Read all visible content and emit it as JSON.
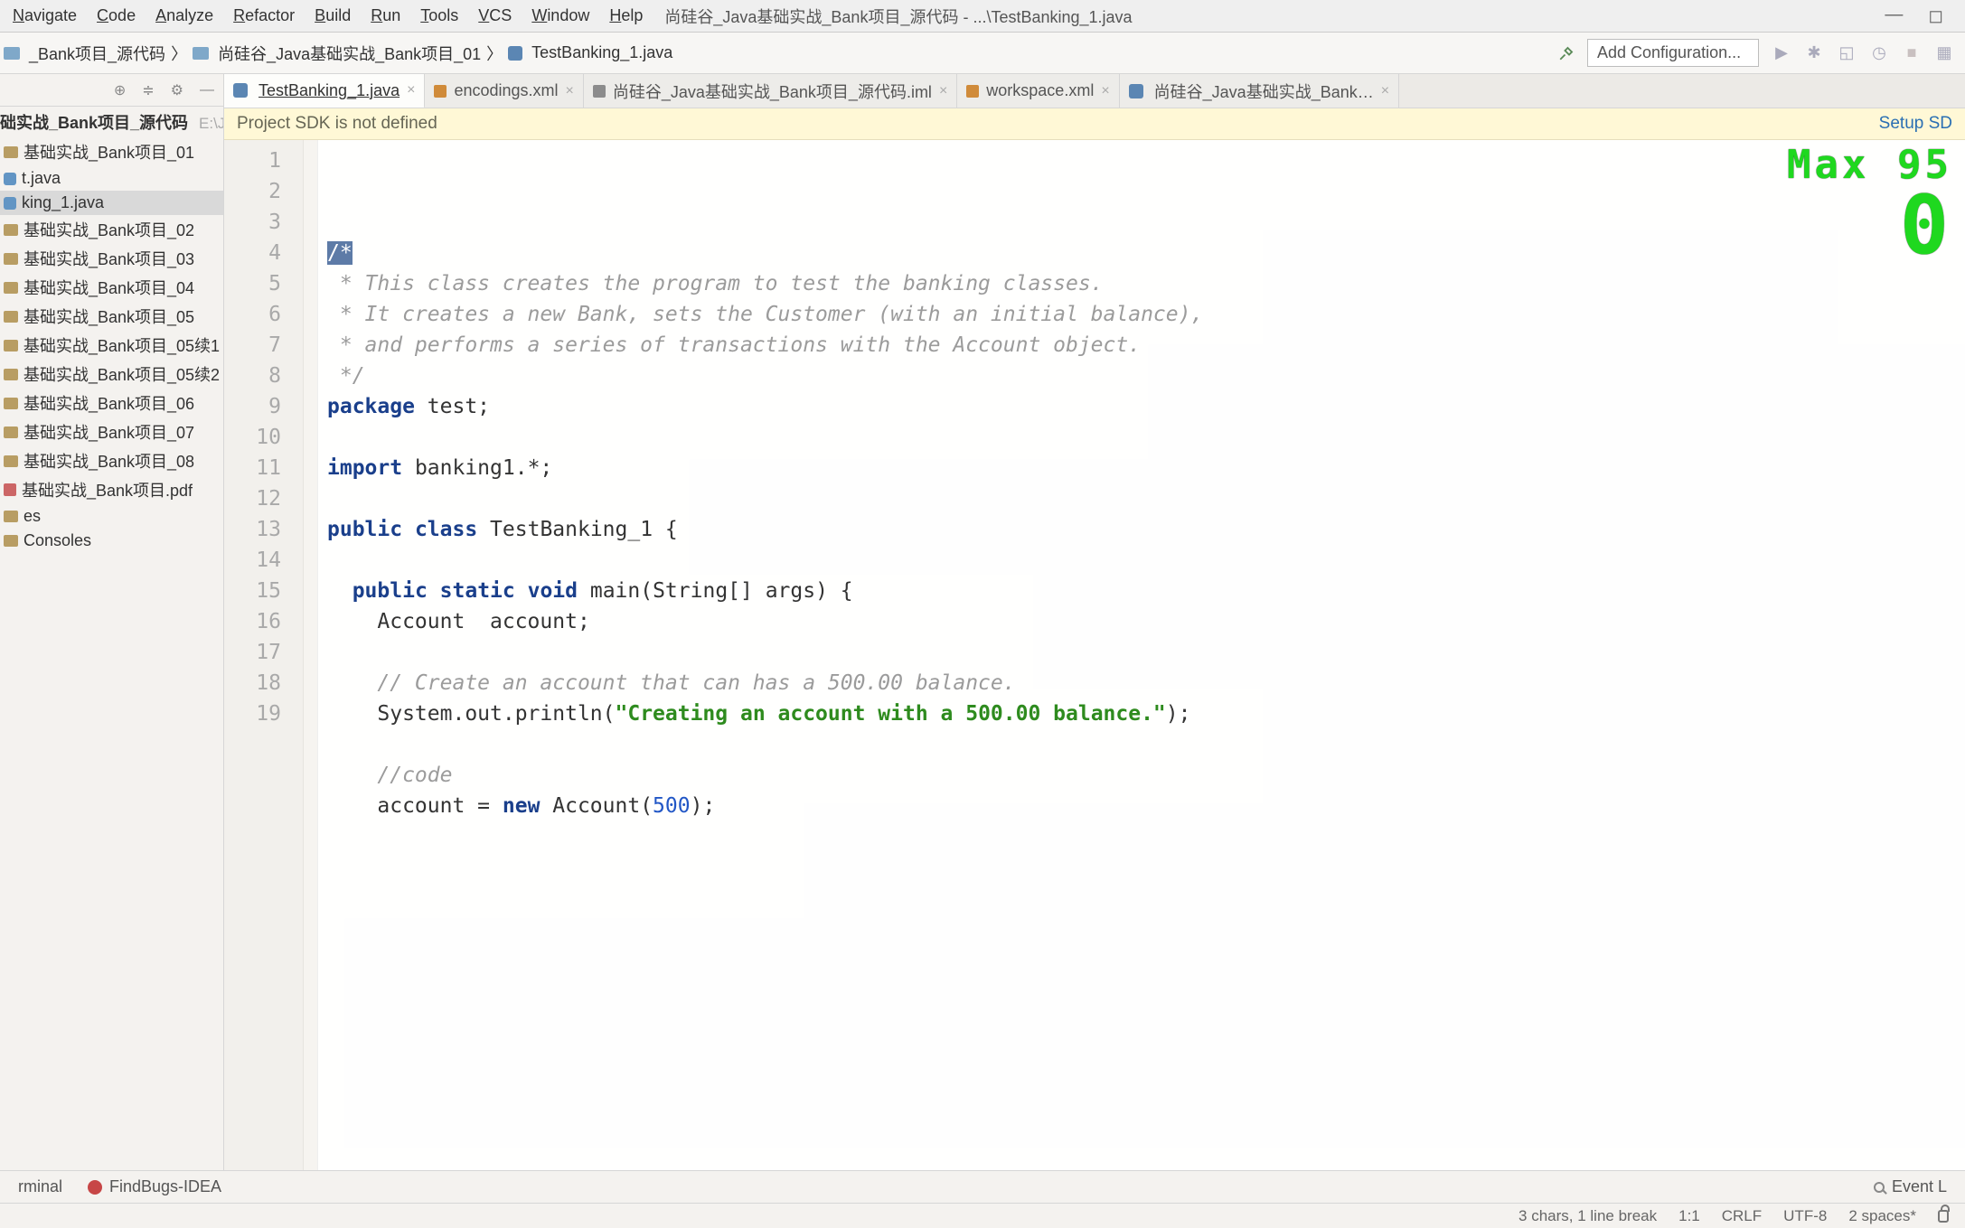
{
  "menu": [
    "Navigate",
    "Code",
    "Analyze",
    "Refactor",
    "Build",
    "Run",
    "Tools",
    "VCS",
    "Window",
    "Help"
  ],
  "window_title": "尚硅谷_Java基础实战_Bank项目_源代码 - ...\\TestBanking_1.java",
  "breadcrumbs": [
    {
      "icon": "folder",
      "label": "_Bank项目_源代码"
    },
    {
      "icon": "folder",
      "label": "尚硅谷_Java基础实战_Bank项目_01"
    },
    {
      "icon": "java",
      "label": "TestBanking_1.java"
    }
  ],
  "run_config_placeholder": "Add Configuration...",
  "sidebar": {
    "root_name": "础实战_Bank项目_源代码",
    "root_path": "E:\\Java基础",
    "items": [
      {
        "icon": "folder",
        "label": "基础实战_Bank项目_01",
        "selected": false
      },
      {
        "icon": "java",
        "label": "t.java",
        "selected": false
      },
      {
        "icon": "java",
        "label": "king_1.java",
        "selected": true
      },
      {
        "icon": "folder",
        "label": "基础实战_Bank项目_02",
        "selected": false
      },
      {
        "icon": "folder",
        "label": "基础实战_Bank项目_03",
        "selected": false
      },
      {
        "icon": "folder",
        "label": "基础实战_Bank项目_04",
        "selected": false
      },
      {
        "icon": "folder",
        "label": "基础实战_Bank项目_05",
        "selected": false
      },
      {
        "icon": "folder",
        "label": "基础实战_Bank项目_05续1",
        "selected": false
      },
      {
        "icon": "folder",
        "label": "基础实战_Bank项目_05续2",
        "selected": false
      },
      {
        "icon": "folder",
        "label": "基础实战_Bank项目_06",
        "selected": false
      },
      {
        "icon": "folder",
        "label": "基础实战_Bank项目_07",
        "selected": false
      },
      {
        "icon": "folder",
        "label": "基础实战_Bank项目_08",
        "selected": false
      },
      {
        "icon": "pdf",
        "label": "基础实战_Bank项目.pdf",
        "selected": false
      },
      {
        "icon": "folder",
        "label": "es",
        "selected": false
      },
      {
        "icon": "folder",
        "label": "Consoles",
        "selected": false
      }
    ]
  },
  "tabs": [
    {
      "icon": "java",
      "label": "TestBanking_1.java",
      "active": true
    },
    {
      "icon": "xml",
      "label": "encodings.xml",
      "active": false
    },
    {
      "icon": "iml",
      "label": "尚硅谷_Java基础实战_Bank项目_源代码.iml",
      "active": false
    },
    {
      "icon": "xml",
      "label": "workspace.xml",
      "active": false
    },
    {
      "icon": "java",
      "label": "尚硅谷_Java基础实战_Bank…",
      "active": false
    }
  ],
  "banner": {
    "msg": "Project SDK is not defined",
    "action": "Setup SD"
  },
  "hud": {
    "label": "Max",
    "value": "95",
    "big": "0"
  },
  "code_lines": [
    {
      "n": 1,
      "html": "<span class='sel'>/*</span>"
    },
    {
      "n": 2,
      "html": "<span class='comm'> * This class creates the program to test the banking classes.</span>"
    },
    {
      "n": 3,
      "html": "<span class='comm'> * It creates a new Bank, sets the Customer (with an initial balance),</span>"
    },
    {
      "n": 4,
      "html": "<span class='comm'> * and performs a series of transactions with the Account object.</span>"
    },
    {
      "n": 5,
      "html": "<span class='comm'> */</span>"
    },
    {
      "n": 6,
      "html": "<span class='kw'>package</span> test;"
    },
    {
      "n": 7,
      "html": ""
    },
    {
      "n": 8,
      "html": "<span class='kw'>import</span> banking1.*;"
    },
    {
      "n": 9,
      "html": ""
    },
    {
      "n": 10,
      "html": "<span class='kw'>public</span> <span class='kw'>class</span> TestBanking_1 {"
    },
    {
      "n": 11,
      "html": ""
    },
    {
      "n": 12,
      "html": "  <span class='kw'>public</span> <span class='kw'>static</span> <span class='kw'>void</span> main(String[] args) {"
    },
    {
      "n": 13,
      "html": "    Account  account;"
    },
    {
      "n": 14,
      "html": ""
    },
    {
      "n": 15,
      "html": "    <span class='comm'>// Create an account that can has a 500.00 balance.</span>"
    },
    {
      "n": 16,
      "html": "    System.out.println(<span class='str'>\"Creating an account with a 500.00 balance.\"</span>);"
    },
    {
      "n": 17,
      "html": ""
    },
    {
      "n": 18,
      "html": "    <span class='comm'>//code</span>"
    },
    {
      "n": 19,
      "html": "    account = <span class='kw'>new</span> Account(<span class='num'>500</span>);"
    }
  ],
  "bottom_tools": {
    "terminal": "rminal",
    "findbugs": "FindBugs-IDEA",
    "eventlog": "Event L"
  },
  "status": {
    "sel": "3 chars, 1 line break",
    "pos": "1:1",
    "eol": "CRLF",
    "enc": "UTF-8",
    "indent": "2 spaces*"
  }
}
